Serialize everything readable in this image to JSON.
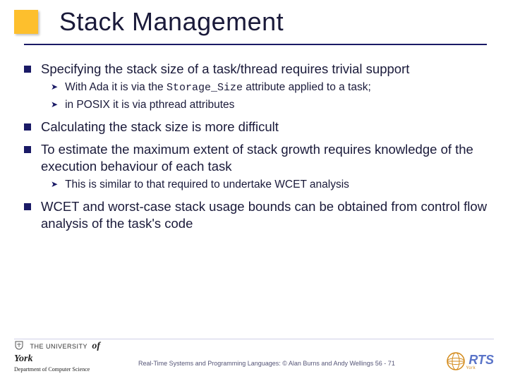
{
  "title": "Stack Management",
  "bullets": [
    {
      "text": "Specifying the stack size of a task/thread requires trivial support",
      "sub": [
        {
          "pre": "With Ada it is via the ",
          "code": "Storage_Size",
          "post": " attribute applied to a task;"
        },
        {
          "pre": "in POSIX it is via pthread attributes",
          "code": "",
          "post": ""
        }
      ]
    },
    {
      "text": "Calculating the stack size is more difficult",
      "sub": []
    },
    {
      "text": "To estimate the maximum extent of stack growth requires knowledge of the execution behaviour of each task",
      "sub": [
        {
          "pre": "This is similar to that required to undertake WCET analysis",
          "code": "",
          "post": ""
        }
      ]
    },
    {
      "text": "WCET and worst-case stack usage bounds can be obtained from control flow analysis of the task's code",
      "sub": []
    }
  ],
  "footer": {
    "copyright": "Real-Time Systems and Programming Languages: © Alan Burns and Andy Wellings  56 - 71",
    "york_uni": "THE UNIVERSITY",
    "york_york": "of York",
    "york_dept": "Department of Computer Science",
    "rts": "RTS",
    "rts_sub": "York"
  }
}
